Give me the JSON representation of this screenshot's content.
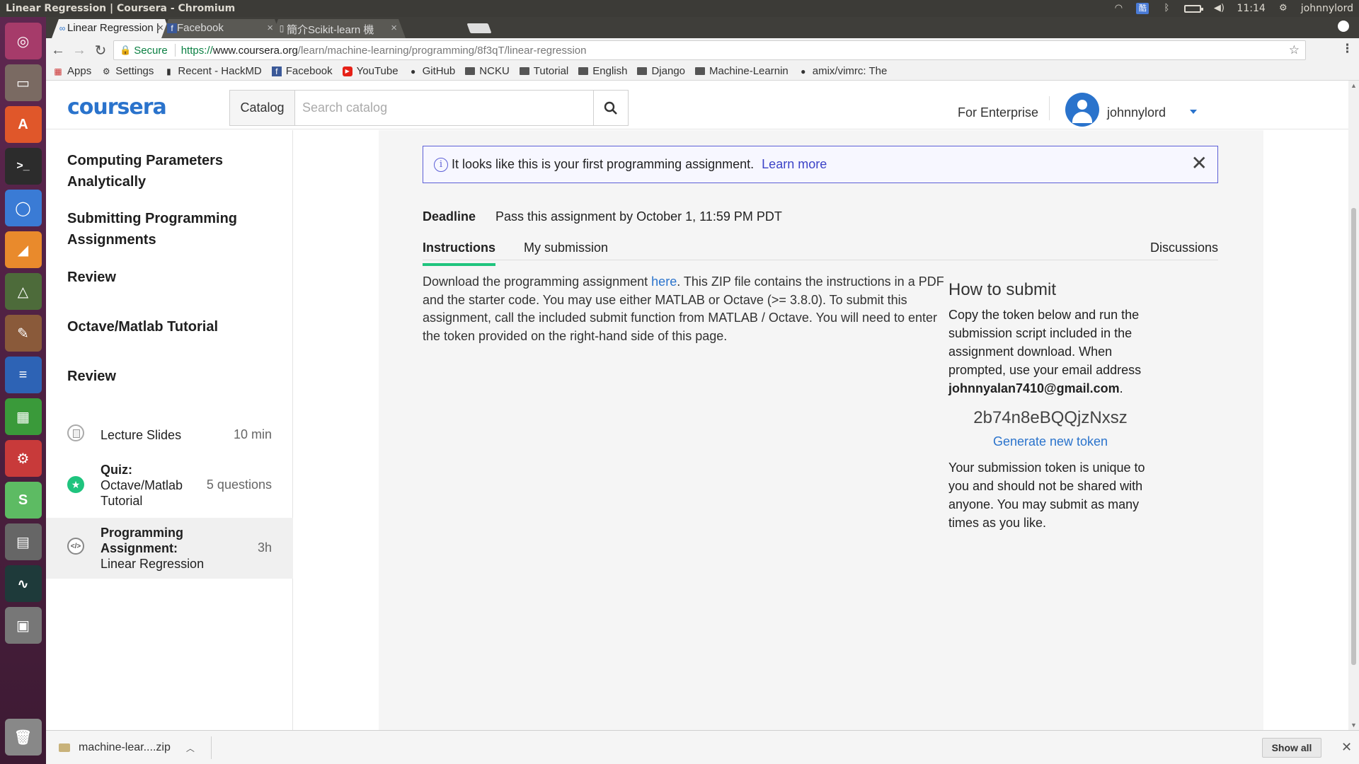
{
  "os_panel": {
    "window_title": "Linear Regression | Coursera - Chromium",
    "time": "11:14",
    "user": "johnnylord"
  },
  "browser": {
    "tabs": [
      {
        "label": "Linear Regression |",
        "active": true
      },
      {
        "label": "Facebook",
        "active": false
      },
      {
        "label": "簡介Scikit-learn 機",
        "active": false
      }
    ],
    "url": {
      "secure_label": "Secure",
      "scheme": "https://",
      "host": "www.coursera.org",
      "path": "/learn/machine-learning/programming/8f3qT/linear-regression"
    },
    "bookmarks": [
      {
        "label": "Apps",
        "icon": "apps-grid-icon"
      },
      {
        "label": "Settings",
        "icon": "gear-icon"
      },
      {
        "label": "Recent - HackMD",
        "icon": "page-icon"
      },
      {
        "label": "Facebook",
        "icon": "facebook-icon"
      },
      {
        "label": "YouTube",
        "icon": "youtube-icon"
      },
      {
        "label": "GitHub",
        "icon": "github-icon"
      },
      {
        "label": "NCKU",
        "icon": "folder-icon"
      },
      {
        "label": "Tutorial",
        "icon": "folder-icon"
      },
      {
        "label": "English",
        "icon": "folder-icon"
      },
      {
        "label": "Django",
        "icon": "folder-icon"
      },
      {
        "label": "Machine-Learnin",
        "icon": "folder-icon"
      },
      {
        "label": "amix/vimrc: The",
        "icon": "github-icon"
      }
    ]
  },
  "header": {
    "logo": "coursera",
    "catalog_label": "Catalog",
    "search_placeholder": "Search catalog",
    "enterprise_label": "For Enterprise",
    "username": "johnnylord",
    "brand_color": "#2a73cc"
  },
  "sidebar": {
    "headings": [
      {
        "line1": "Computing Parameters",
        "line2": "Analytically"
      },
      {
        "line1": "Submitting Programming",
        "line2": "Assignments"
      },
      {
        "line1": "Review",
        "line2": ""
      },
      {
        "line1": "Octave/Matlab Tutorial",
        "line2": ""
      },
      {
        "line1": "Review",
        "line2": ""
      }
    ],
    "items": [
      {
        "type_label": "",
        "title": "Lecture Slides",
        "meta": "10 min",
        "icon": "slides-icon"
      },
      {
        "type_label": "Quiz:",
        "title_line1": "Octave/Matlab",
        "title_line2": "Tutorial",
        "meta": "5 questions",
        "icon": "quiz-star-icon"
      },
      {
        "type_label1": "Programming",
        "type_label2": "Assignment:",
        "title": "Linear Regression",
        "meta": "3h",
        "icon": "code-icon",
        "selected": true
      }
    ]
  },
  "main": {
    "banner": {
      "text": "It looks like this is your first programming assignment.",
      "link": "Learn more"
    },
    "deadline_label": "Deadline",
    "deadline_value": "Pass this assignment by October 1, 11:59 PM PDT",
    "tabs": [
      {
        "label": "Instructions",
        "active": true
      },
      {
        "label": "My submission",
        "active": false
      },
      {
        "label": "Discussions",
        "active": false
      }
    ],
    "instructions": {
      "before_link": "Download the programming assignment ",
      "link": "here",
      "after_link": ". This ZIP file contains the instructions in a PDF and the starter code. You may use either MATLAB or Octave (>= 3.8.0). To submit this assignment, call the included submit function from MATLAB / Octave. You will need to enter the token provided on the right-hand side of this page."
    },
    "how_to_submit": {
      "title": "How to submit",
      "body": "Copy the token below and run the submission script included in the assignment download. When prompted, use your email address",
      "email": "johnnyalan7410@gmail.com",
      "token": "2b74n8eBQQjzNxsz",
      "generate_label": "Generate new token",
      "note": "Your submission token is unique to you and should not be shared with anyone. You may submit as many times as you like."
    }
  },
  "downloads": {
    "file": "machine-lear....zip",
    "show_all": "Show all"
  }
}
